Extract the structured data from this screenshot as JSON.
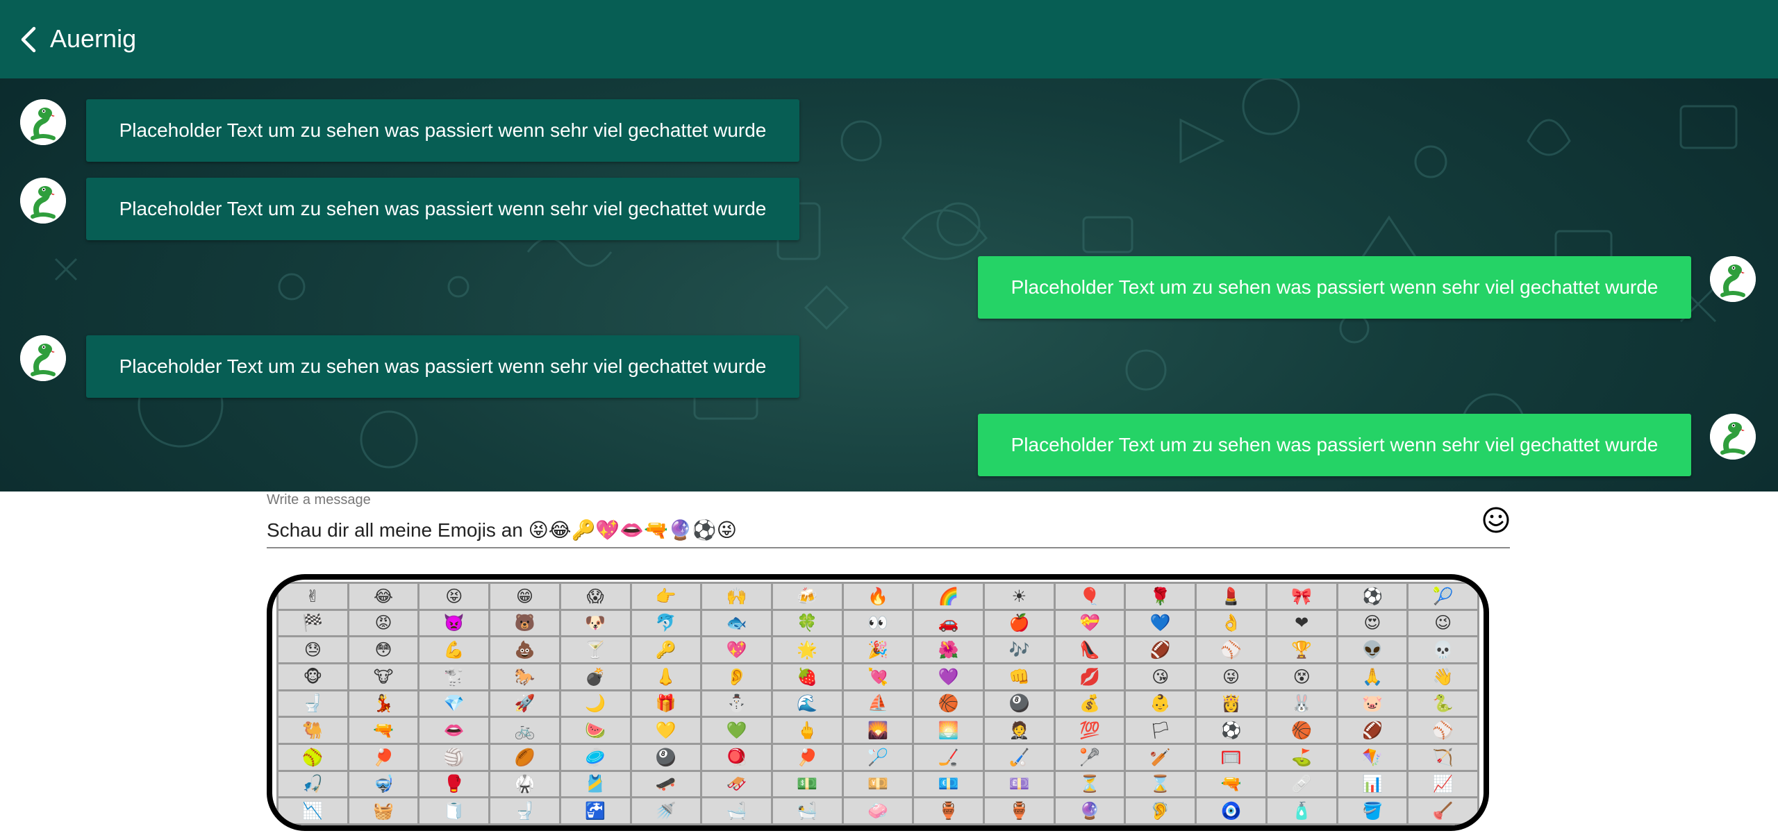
{
  "header": {
    "title": "Auernig"
  },
  "messages": [
    {
      "side": "in",
      "text": "Placeholder Text um zu sehen was passiert wenn sehr viel gechattet wurde"
    },
    {
      "side": "in",
      "text": "Placeholder Text um zu sehen was passiert wenn sehr viel gechattet wurde"
    },
    {
      "side": "out",
      "text": "Placeholder Text um zu sehen was passiert wenn sehr viel gechattet wurde"
    },
    {
      "side": "in",
      "text": "Placeholder Text um zu sehen was passiert wenn sehr viel gechattet wurde"
    },
    {
      "side": "out",
      "text": "Placeholder Text um zu sehen was passiert wenn sehr viel gechattet wurde"
    }
  ],
  "composer": {
    "label": "Write a message",
    "value": "Schau dir all meine Emojis an 😝😂🔑💖👄🔫🔮⚽😜"
  },
  "emoji_grid": [
    [
      "✌",
      "😂",
      "😝",
      "😁",
      "😱",
      "👉",
      "🙌",
      "🍻",
      "🔥",
      "🌈",
      "☀",
      "🎈",
      "🌹",
      "💄",
      "🎀",
      "⚽",
      "🎾"
    ],
    [
      "🏁",
      "😡",
      "👿",
      "🐻",
      "🐶",
      "🐬",
      "🐟",
      "🍀",
      "👀",
      "🚗",
      "🍎",
      "💝",
      "💙",
      "👌",
      "❤",
      "😍",
      "😉"
    ],
    [
      "😓",
      "😳",
      "💪",
      "💩",
      "🍸",
      "🔑",
      "💖",
      "🌟",
      "🎉",
      "🌺",
      "🎶",
      "👠",
      "🏈",
      "⚾",
      "🏆",
      "👽",
      "💀"
    ],
    [
      "🐵",
      "🐮",
      "🐩",
      "🐎",
      "💣",
      "👃",
      "👂",
      "🍓",
      "💘",
      "💜",
      "👊",
      "💋",
      "😘",
      "😜",
      "😵",
      "🙏",
      "👋"
    ],
    [
      "🚽",
      "💃",
      "💎",
      "🚀",
      "🌙",
      "🎁",
      "⛄",
      "🌊",
      "⛵",
      "🏀",
      "🎱",
      "💰",
      "👶",
      "👸",
      "🐰",
      "🐷",
      "🐍"
    ],
    [
      "🐫",
      "🔫",
      "👄",
      "🚲",
      "🍉",
      "💛",
      "💚",
      "🖕",
      "🌄",
      "🌅",
      "🤵",
      "💯",
      "🏳",
      "⚽",
      "🏀",
      "🏈",
      "⚾"
    ],
    [
      "🥎",
      "🏓",
      "🏐",
      "🏉",
      "🥏",
      "🎱",
      "🪀",
      "🏓",
      "🏸",
      "🏒",
      "🏑",
      "🥍",
      "🏏",
      "🥅",
      "⛳",
      "🪁",
      "🏹"
    ],
    [
      "🎣",
      "🤿",
      "🥊",
      "🥋",
      "🎽",
      "🛹",
      "🛷",
      "💵",
      "💴",
      "💶",
      "💷",
      "⏳",
      "⌛",
      "🔫",
      "🩹",
      "📊",
      "📈"
    ],
    [
      "📉",
      "🧺",
      "🧻",
      "🚽",
      "🚰",
      "🚿",
      "🛁",
      "🛀",
      "🧼",
      "🏺",
      "🏺",
      "🔮",
      "🦻",
      "🧿",
      "🧴",
      "🪣",
      "🪠"
    ]
  ],
  "colors": {
    "header": "#075e54",
    "incoming": "#075e54",
    "outgoing": "#25d366"
  },
  "icons": {
    "back": "chevron-left-icon",
    "emoji": "smiley-icon",
    "avatar": "green-snake-avatar"
  }
}
